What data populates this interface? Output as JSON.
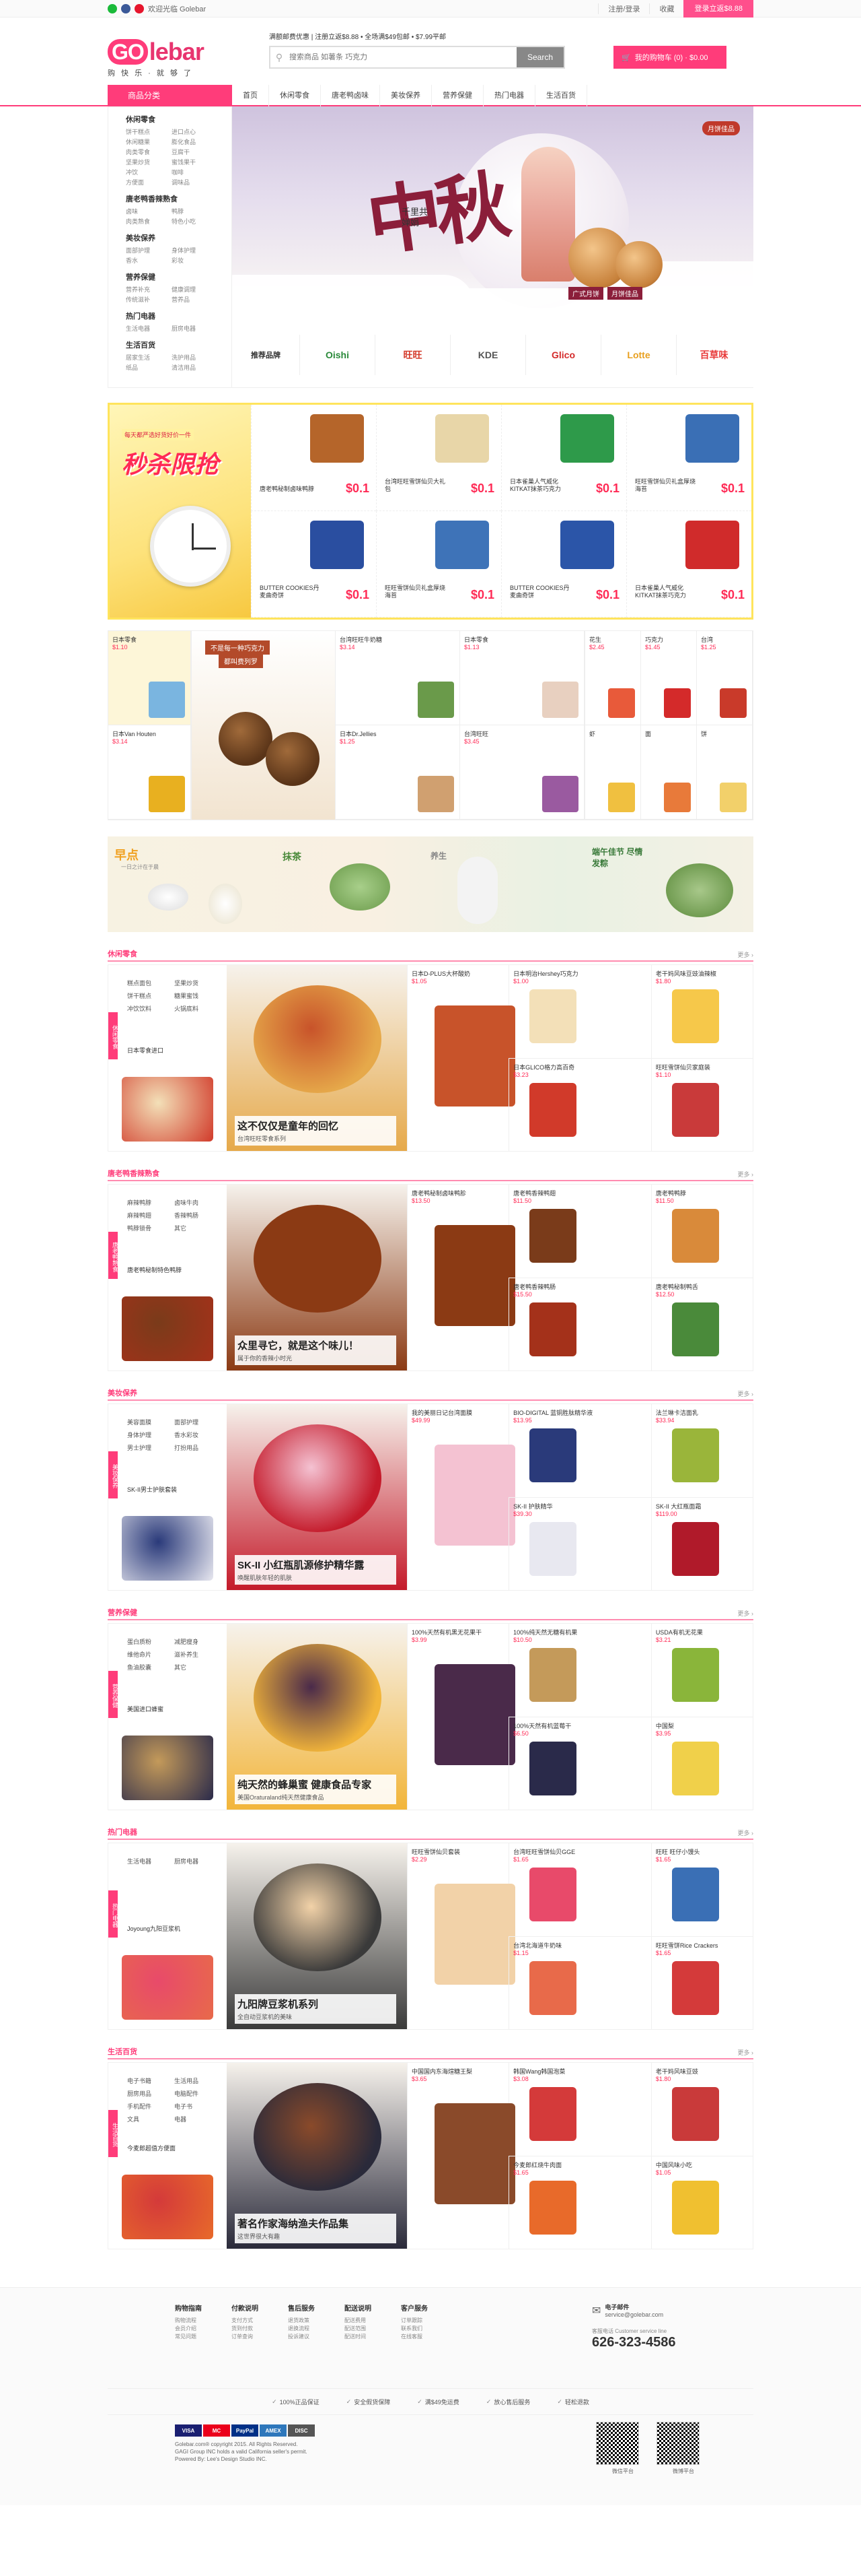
{
  "topbar": {
    "welcome": "欢迎光临 Golebar",
    "links": [
      "注册/登录",
      "收藏"
    ],
    "cart_btn": "登录立返$8.88"
  },
  "header": {
    "logo_go": "GO",
    "logo_lebar": "lebar",
    "slogan": "购 快 乐 · 就 够 了",
    "promo": "满额邮费优惠 | 注册立返$8.88 • 全场满$49包邮 • $7.99平邮",
    "search_placeholder": "搜索商品 如薯条 巧克力",
    "search_btn": "Search",
    "cart": "我的购物车 (0) · $0.00"
  },
  "nav": {
    "cat_label": "商品分类",
    "items": [
      "首页",
      "休闲零食",
      "唐老鸭卤味",
      "美妆保养",
      "营养保健",
      "热门电器",
      "生活百货"
    ]
  },
  "sidebar": [
    {
      "title": "休闲零食",
      "subs": [
        "饼干糕点",
        "进口点心",
        "休闲糖果",
        "膨化食品",
        "肉类零食",
        "豆腐干",
        "坚果炒货",
        "蜜饯果干",
        "冲饮",
        "咖啡",
        "方便面",
        "调味品"
      ]
    },
    {
      "title": "唐老鸭香辣熟食",
      "subs": [
        "卤味",
        "鸭脖",
        "肉类熟食",
        "特色小吃"
      ]
    },
    {
      "title": "美妆保养",
      "subs": [
        "面部护理",
        "身体护理",
        "香水",
        "彩妆"
      ]
    },
    {
      "title": "营养保健",
      "subs": [
        "营养补充",
        "健康调理",
        "传统滋补",
        "营养品"
      ]
    },
    {
      "title": "热门电器",
      "subs": [
        "生活电器",
        "厨房电器"
      ]
    },
    {
      "title": "生活百货",
      "subs": [
        "居家生活",
        "洗护用品",
        "纸品",
        "清洁用品"
      ]
    }
  ],
  "banner": {
    "title": "中秋",
    "verse": "千里共婵娟",
    "tags": [
      "广式月饼",
      "月饼佳品"
    ],
    "stamp": "月饼佳品"
  },
  "brands": {
    "label": "推荐品牌",
    "items": [
      "Oishi",
      "旺旺",
      "KDE",
      "Glico",
      "Lotte",
      "百草味"
    ]
  },
  "flash": {
    "title": "秒杀限抢",
    "subtitle": "每天都严选好货好价一件",
    "items": [
      {
        "name": "唐老鸭秘制卤味鸭脖",
        "price": "$0.1",
        "color": "#b5652a"
      },
      {
        "name": "台湾旺旺雪饼仙贝大礼包",
        "price": "$0.1",
        "color": "#e8d6a8"
      },
      {
        "name": "日本雀巢人气威化KITKAT抹茶巧克力",
        "price": "$0.1",
        "color": "#2e9a4a"
      },
      {
        "name": "旺旺雪饼仙贝礼盒厚烧海苔",
        "price": "$0.1",
        "color": "#3a6fb5"
      },
      {
        "name": "BUTTER COOKIES丹麦曲奇饼",
        "price": "$0.1",
        "color": "#2a4ea0"
      },
      {
        "name": "旺旺雪饼仙贝礼盒厚烧海苔",
        "price": "$0.1",
        "color": "#3e73b8"
      },
      {
        "name": "BUTTER COOKIES丹麦曲奇饼",
        "price": "$0.1",
        "color": "#2b55a8"
      },
      {
        "name": "日本雀巢人气威化KITKAT抹茶巧克力",
        "price": "$0.1",
        "color": "#d02b2b"
      }
    ]
  },
  "mosaic": {
    "a": [
      {
        "name": "日本零食",
        "price": "$1.10"
      },
      {
        "name": "日本Van Houten",
        "price": "$3.14"
      }
    ],
    "b": {
      "line1": "不是每一种巧克力",
      "line2": "都叫费列罗"
    },
    "c": [
      {
        "name": "台湾旺旺牛奶糖",
        "price": "$3.14"
      },
      {
        "name": "日本零食",
        "price": "$1.13"
      },
      {
        "name": "日本Dr.Jellies",
        "price": "$1.25"
      },
      {
        "name": "台湾旺旺",
        "price": "$3.45"
      }
    ],
    "d": [
      {
        "name": "花生",
        "price": "$2.45"
      },
      {
        "name": "巧克力",
        "price": "$1.45"
      },
      {
        "name": "台湾",
        "price": "$1.25"
      },
      {
        "name": "虾",
        "price": ""
      },
      {
        "name": "面",
        "price": ""
      },
      {
        "name": "饼",
        "price": ""
      }
    ]
  },
  "breakfast": {
    "t1": "早点",
    "t2": "一日之计在于晨",
    "t3": "抹茶",
    "t4": "养生",
    "t5": "端午佳节 尽情发粽"
  },
  "sections": [
    {
      "key": "snack",
      "title": "休闲零食",
      "tag": "休闲零食",
      "links": [
        "糕点面包",
        "坚果炒货",
        "饼干糕点",
        "糖果蜜饯",
        "冲饮饮料",
        "火锅底料"
      ],
      "feat": "日本零食进口",
      "cap1": "这不仅仅是童年的回忆",
      "cap2": "台湾旺旺零食系列",
      "grid": [
        {
          "name": "日本明治Hershey巧克力",
          "price": "$1.00"
        },
        {
          "name": "日本D-PLUS大杯酸奶",
          "price": "$1.05"
        },
        {
          "name": "老干妈风味豆豉油辣椒",
          "price": "$1.80"
        },
        {
          "name": "日本GLICO格力高百奇",
          "price": "$3.23"
        },
        {
          "name": "",
          "price": ""
        },
        {
          "name": "旺旺雪饼仙贝家庭装",
          "price": "$1.10"
        }
      ],
      "colors": [
        "#f3e0b8",
        "#c8532a",
        "#f6c84a",
        "#d13a2a",
        "#2a6fb5",
        "#c93a3a"
      ],
      "heroColor": "#e6a94a"
    },
    {
      "key": "duck",
      "title": "唐老鸭香辣熟食",
      "tag": "唐老鸭熟食",
      "links": [
        "麻辣鸭脖",
        "卤味牛肉",
        "麻辣鸭翅",
        "香辣鸭肠",
        "鸭脖锁骨",
        "其它"
      ],
      "feat": "唐老鸭秘制特色鸭脖",
      "cap1": "众里寻它，就是这个味儿！",
      "cap2": "属于你的香辣小时光",
      "grid": [
        {
          "name": "唐老鸭香辣鸭翅",
          "price": "$11.50"
        },
        {
          "name": "唐老鸭秘制卤味鸭胗",
          "price": "$13.50"
        },
        {
          "name": "唐老鸭鸭脖",
          "price": "$11.50"
        },
        {
          "name": "唐老鸭香辣鸭肠",
          "price": "$15.50"
        },
        {
          "name": "",
          "price": ""
        },
        {
          "name": "唐老鸭秘制鸭舌",
          "price": "$12.50"
        }
      ],
      "colors": [
        "#7a3b1a",
        "#8b3a14",
        "#d98a3a",
        "#a4311a",
        "#6b2f12",
        "#4a8a3a"
      ],
      "heroColor": "#8b3a14"
    },
    {
      "key": "beauty",
      "title": "美妆保养",
      "tag": "美妆保养",
      "links": [
        "美容面膜",
        "面部护理",
        "身体护理",
        "香水彩妆",
        "男士护理",
        "打扮用品"
      ],
      "feat": "SK-II男士护肤套装",
      "cap1": "SK-II 小红瓶肌源修护精华露",
      "cap2": "唤醒肌肤年轻的肌肤",
      "grid": [
        {
          "name": "BIO-DIGITAL 蓝铜胜肽精华液",
          "price": "$13.95"
        },
        {
          "name": "我的美丽日记台湾面膜",
          "price": "$49.99"
        },
        {
          "name": "法兰琳卡洁面乳",
          "price": "$33.94"
        },
        {
          "name": "SK-II 护肤精华",
          "price": "$39.30"
        },
        {
          "name": "",
          "price": ""
        },
        {
          "name": "SK-II 大红瓶面霜",
          "price": "$119.00"
        }
      ],
      "colors": [
        "#2a3a7a",
        "#f4c2d2",
        "#9ab53a",
        "#e8e8f0",
        "#f6d5e0",
        "#b01a2a"
      ],
      "heroColor": "#c41a2a"
    },
    {
      "key": "health",
      "title": "营养保健",
      "tag": "营养保健",
      "links": [
        "蛋白质粉",
        "减肥瘦身",
        "维他命片",
        "滋补养生",
        "鱼油胶囊",
        "其它"
      ],
      "feat": "美国进口蜂蜜",
      "cap1": "纯天然的蜂巢蜜 健康食品专家",
      "cap2": "美国Oraturaland纯天然健康食品",
      "grid": [
        {
          "name": "100%纯天然无糖有机果",
          "price": "$10.50"
        },
        {
          "name": "100%天然有机黑无花果干",
          "price": "$3.99"
        },
        {
          "name": "USDA有机无花果",
          "price": "$3.21"
        },
        {
          "name": "100%天然有机蓝莓干",
          "price": "$6.50"
        },
        {
          "name": "",
          "price": ""
        },
        {
          "name": "中国梨",
          "price": "$3.95"
        }
      ],
      "colors": [
        "#c49a5a",
        "#4a2a4a",
        "#8ab53a",
        "#2a2a4a",
        "#6a3a5a",
        "#f0d04a"
      ],
      "heroColor": "#f2b53a"
    },
    {
      "key": "appliance",
      "title": "热门电器",
      "tag": "热门电器",
      "links": [
        "生活电器",
        "厨房电器"
      ],
      "feat": "Joyoung九阳豆浆机",
      "cap1": "九阳牌豆浆机系列",
      "cap2": "全自动豆浆机的美味",
      "grid": [
        {
          "name": "台湾旺旺雪饼仙贝GGE",
          "price": "$1.65"
        },
        {
          "name": "旺旺雪饼仙贝套装",
          "price": "$2.29"
        },
        {
          "name": "旺旺 旺仔小馒头",
          "price": "$1.65"
        },
        {
          "name": "台湾北海道牛奶味",
          "price": "$1.15"
        },
        {
          "name": "",
          "price": ""
        },
        {
          "name": "旺旺雪饼Rice Crackers",
          "price": "$1.65"
        }
      ],
      "colors": [
        "#e84a6a",
        "#f2d2a8",
        "#3a6fb5",
        "#e86a4a",
        "#e8c88a",
        "#d43a3a"
      ],
      "heroColor": "#3a3a3a"
    },
    {
      "key": "living",
      "title": "生活百货",
      "tag": "生活百货",
      "links": [
        "电子书籍",
        "生活用品",
        "厨房用品",
        "电脑配件",
        "手机配件",
        "电子书",
        "文具",
        "电器"
      ],
      "feat": "今麦郎超值方便面",
      "cap1": "著名作家海纳渔夫作品集",
      "cap2": "这世界很大有趣",
      "grid": [
        {
          "name": "韩国Wang韩国泡菜",
          "price": "$3.08"
        },
        {
          "name": "中国国内东海煊糖王梨",
          "price": "$3.65"
        },
        {
          "name": "老干妈风味豆豉",
          "price": "$1.80"
        },
        {
          "name": "今麦郎红烧牛肉面",
          "price": "$1.65"
        },
        {
          "name": "",
          "price": ""
        },
        {
          "name": "中国风味小吃",
          "price": "$1.05"
        }
      ],
      "colors": [
        "#d43a3a",
        "#8a4a2a",
        "#c93a3a",
        "#e86a2a",
        "#3a4a6a",
        "#f0c030"
      ],
      "heroColor": "#2a2a3a"
    }
  ],
  "footer": {
    "cols": [
      {
        "title": "购物指南",
        "items": [
          "购物流程",
          "会员介绍",
          "常见问题"
        ]
      },
      {
        "title": "付款说明",
        "items": [
          "支付方式",
          "货到付款",
          "订单查询"
        ]
      },
      {
        "title": "售后服务",
        "items": [
          "退货政策",
          "退换流程",
          "投诉建议"
        ]
      },
      {
        "title": "配送说明",
        "items": [
          "配送费用",
          "配送范围",
          "配送时间"
        ]
      },
      {
        "title": "客户服务",
        "items": [
          "订单跟踪",
          "联系我们",
          "在线客服"
        ]
      }
    ],
    "email_label": "电子邮件",
    "email": "service@golebar.com",
    "phone_label": "客服电话 Customer service line",
    "phone": "626-323-4586",
    "badges": [
      "100%正品保证",
      "安全假货保障",
      "满$49免运费",
      "放心售后服务",
      "轻松退款"
    ],
    "cards": [
      "VISA",
      "MC",
      "PayPal",
      "AMEX",
      "DISC"
    ],
    "copy1": "Golebar.com® copyright 2015. All Rights Reserved.",
    "copy2": "GAGI Group INC holds a valid California seller's permit.",
    "copy3": "Powered By: Lee's Design Studio INC.",
    "qr1": "微信平台",
    "qr2": "微博平台"
  }
}
